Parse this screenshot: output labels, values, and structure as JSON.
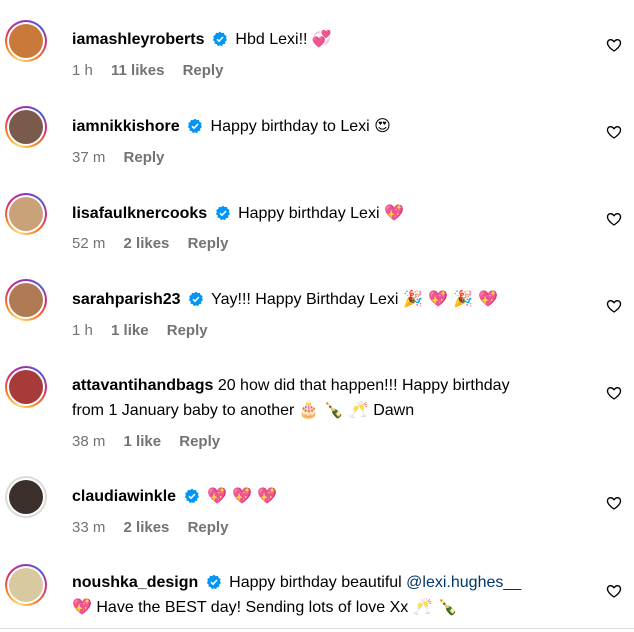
{
  "comments": [
    {
      "username": "iamashleyroberts",
      "text": "Hbd Lexi!!",
      "emoji": "💞",
      "time": "1 h",
      "likes": "11 likes",
      "reply": "Reply",
      "avatar_color": "#c97a3a"
    },
    {
      "username": "iamnikkishore",
      "text": "Happy birthday to Lexi",
      "emoji": "😍",
      "time": "37 m",
      "likes": "",
      "reply": "Reply",
      "avatar_color": "#7a5a4a"
    },
    {
      "username": "lisafaulknercooks",
      "text": "Happy birthday Lexi",
      "emoji": "💖",
      "time": "52 m",
      "likes": "2 likes",
      "reply": "Reply",
      "avatar_color": "#c9a27a"
    },
    {
      "username": "sarahparish23",
      "text": "Yay!!! Happy Birthday Lexi",
      "emoji": "🎉 💖 🎉 💖",
      "time": "1 h",
      "likes": "1 like",
      "reply": "Reply",
      "avatar_color": "#b07a55"
    },
    {
      "username": "attavantihandbags",
      "text": "20 how did that happen!!! Happy birthday",
      "text2": "from 1 January baby to another",
      "emoji2": "🎂 🍾 🥂",
      "text2b": "Dawn",
      "time": "38 m",
      "likes": "1 like",
      "reply": "Reply",
      "avatar_color": "#a83a3a"
    },
    {
      "username": "claudiawinkle",
      "text": "",
      "emoji": "💖 💖 💖",
      "time": "33 m",
      "likes": "2 likes",
      "reply": "Reply",
      "avatar_color": "#3a2f2a"
    },
    {
      "username": "noushka_design",
      "text": "Happy birthday beautiful",
      "mention": "@lexi.hughes__",
      "emoji2": "💖",
      "text2": "Have the BEST day! Sending lots of love Xx",
      "emoji3": "🥂 🍾",
      "time": "",
      "likes": "",
      "reply": "",
      "avatar_color": "#d9c9a0"
    }
  ],
  "colors": {
    "verified": "#0095f6",
    "meta": "#737373",
    "mention": "#00376b"
  },
  "icons": {
    "verified": "verified-badge-icon",
    "like": "heart-outline-icon"
  }
}
